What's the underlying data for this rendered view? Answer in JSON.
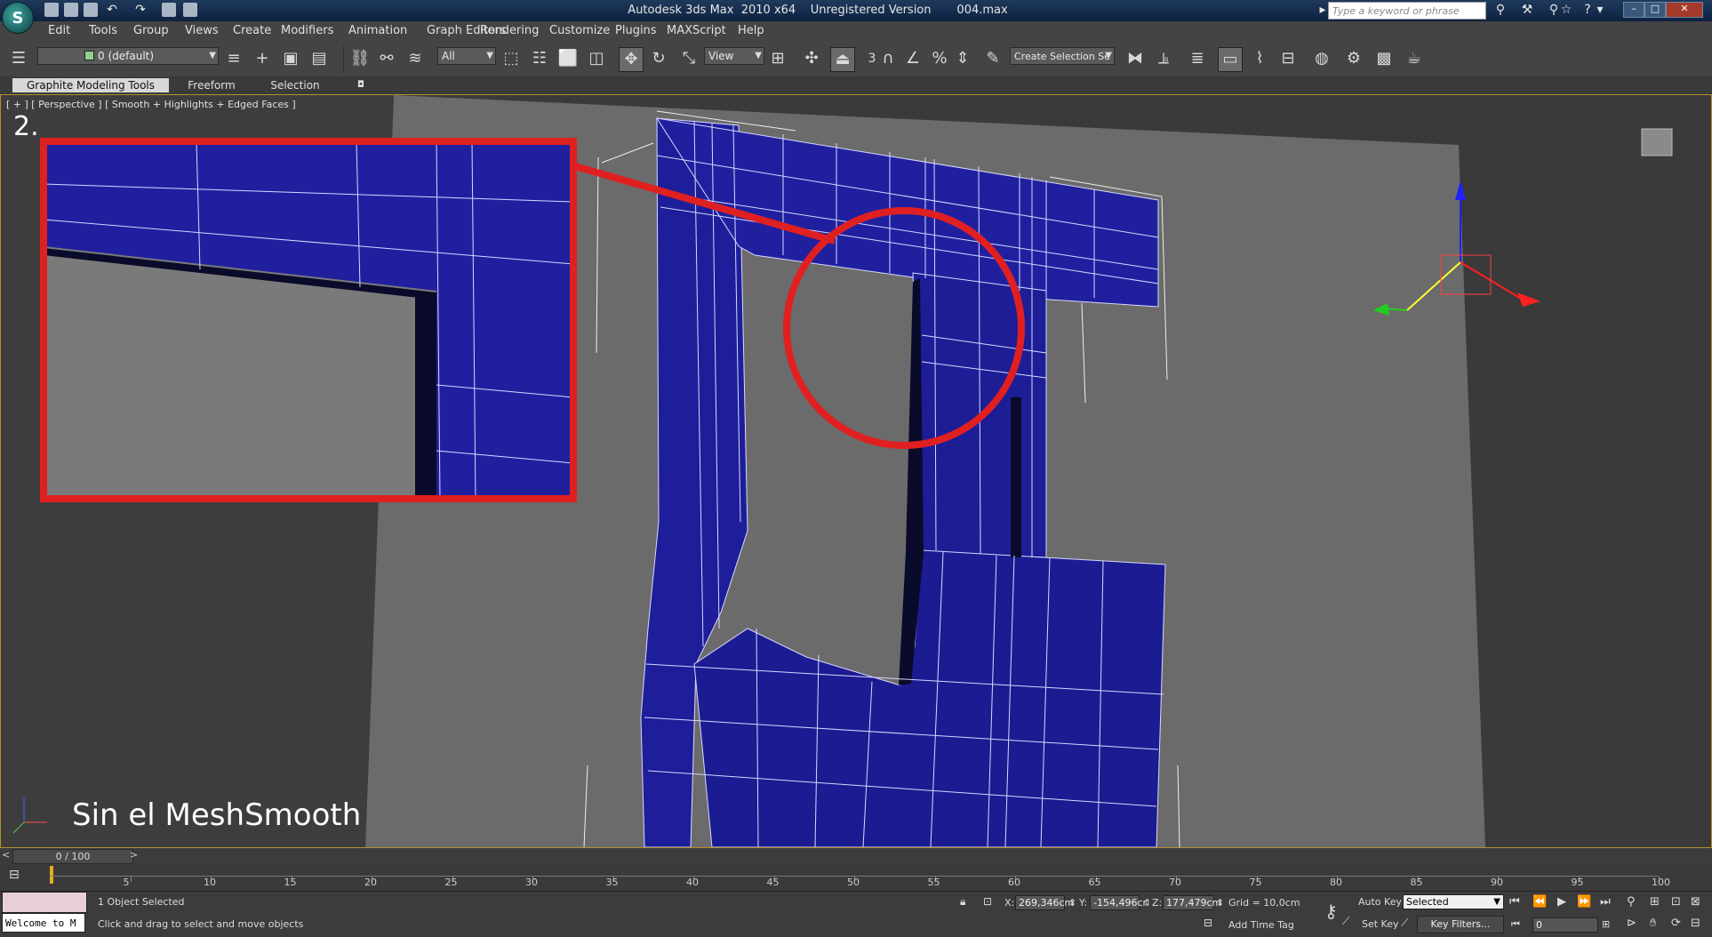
{
  "window": {
    "title": "Autodesk 3ds Max  2010 x64    Unregistered Version       004.max",
    "search_placeholder": "Type a keyword or phrase",
    "app_icon_letter": "S"
  },
  "menu": [
    "Edit",
    "Tools",
    "Group",
    "Views",
    "Create",
    "Modifiers",
    "Animation",
    "Graph Editors",
    "Rendering",
    "Customize",
    "Plugins",
    "MAXScript",
    "Help"
  ],
  "toolbar": {
    "layer_value": "0 (default)",
    "filter_value": "All",
    "reference_value": "View",
    "selection_set_value": "Create Selection Se",
    "snap_label": "3"
  },
  "ribbon_tabs": [
    "Graphite Modeling Tools",
    "Freeform",
    "Selection"
  ],
  "viewport": {
    "label": "[ + ] [ Perspective ] [ Smooth + Highlights + Edged Faces ]",
    "step_number": "2.",
    "caption": "Sin el MeshSmooth",
    "mesh_color": "#1e1e9a",
    "highlight_color": "#e02020"
  },
  "timeline": {
    "frame_display": "0 / 100",
    "ticks": [
      5,
      10,
      15,
      20,
      25,
      30,
      35,
      40,
      45,
      50,
      55,
      60,
      65,
      70,
      75,
      80,
      85,
      90,
      95,
      100
    ]
  },
  "status": {
    "listener": "Welcome to M",
    "selection_info": "1 Object Selected",
    "prompt": "Click and drag to select and move objects",
    "x_label": "X:",
    "x_value": "269,346cm",
    "y_label": "Y:",
    "y_value": "-154,496cr",
    "z_label": "Z:",
    "z_value": "177,479cm",
    "grid": "Grid = 10,0cm",
    "add_time_tag": "Add Time Tag",
    "auto_key": "Auto Key",
    "set_key": "Set Key",
    "selected_value": "Selected",
    "key_filters": "Key Filters...",
    "frame_value": "0"
  }
}
